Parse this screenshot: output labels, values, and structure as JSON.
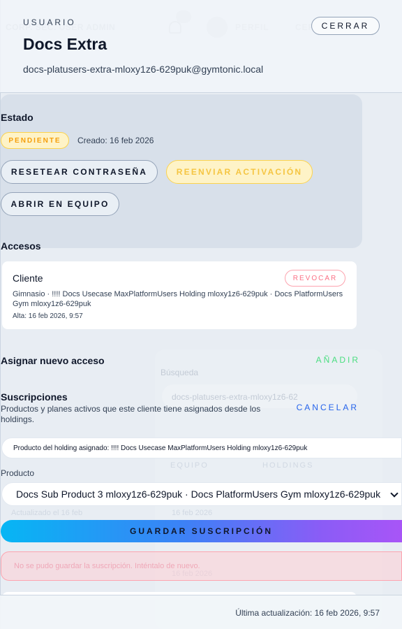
{
  "background": {
    "company_label": "CORP. SEC. USER ADMIN",
    "notifications_badge": "4",
    "profile_label": "PERFIL",
    "close_label": "CER",
    "search_label": "Búsqueda",
    "email_value": "docs-platusers-extra-mloxy1z6-62",
    "tab_one": "EQUIPO",
    "tab_two": "HOLDINGS",
    "date_one": "16 feb 2026",
    "date_two": "16 feb 2026",
    "left_note": "Actualizado el 16 feb"
  },
  "header": {
    "eyebrow": "USUARIO",
    "name": "Docs Extra",
    "email": "docs-platusers-extra-mloxy1z6-629puk@gymtonic.local",
    "close_label": "CERRAR"
  },
  "status": {
    "title": "Estado",
    "badge": "PENDIENTE",
    "created": "Creado: 16 feb 2026",
    "reset_label": "RESETEAR CONTRASEÑA",
    "resend_label": "REENVIAR ACTIVACIÓN",
    "open_label": "ABRIR EN EQUIPO"
  },
  "accesses": {
    "title": "Accesos",
    "items": [
      {
        "role": "Cliente",
        "revoke_label": "REVOCAR",
        "detail": "Gimnasio · !!!! Docs Usecase MaxPlatformUsers Holding mloxy1z6-629puk · Docs PlatformUsers Gym mloxy1z6-629puk",
        "date": "Alta: 16 feb 2026, 9:57"
      }
    ]
  },
  "assign": {
    "title": "Asignar nuevo acceso",
    "add_label": "AÑADIR"
  },
  "subscriptions": {
    "title": "Suscripciones",
    "description": "Productos y planes activos que este cliente tiene asignados desde los holdings.",
    "cancel_label": "CANCELAR",
    "holding_product": "Producto del holding asignado: !!!! Docs Usecase MaxPlatformUsers Holding mloxy1z6-629puk",
    "product_label": "Producto",
    "product_value": "Docs Sub Product 3 mloxy1z6-629puk · Docs PlatformUsers Gym mloxy1z6-629puk",
    "save_label": "GUARDAR SUSCRIPCIÓN",
    "error_text": "No se pudo guardar la suscripción. Inténtalo de nuevo."
  },
  "footer": {
    "updated": "Última actualización: 16 feb 2026, 9:57"
  }
}
